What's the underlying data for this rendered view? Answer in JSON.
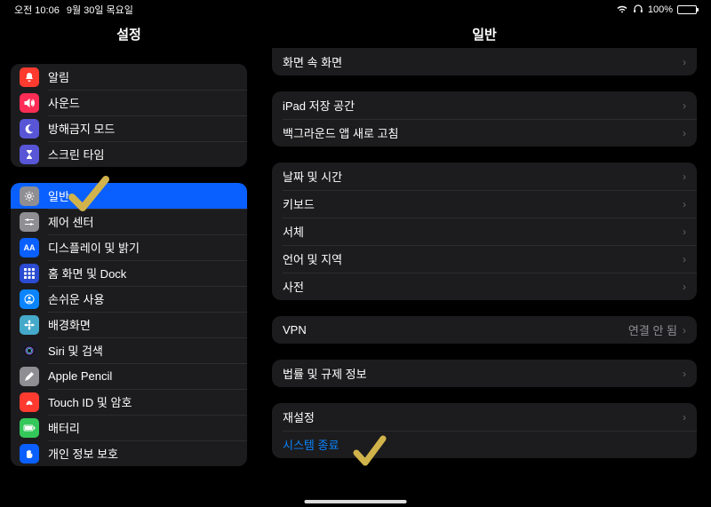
{
  "status": {
    "time": "오전 10:06",
    "date": "9월 30일 목요일",
    "battery": "100%"
  },
  "sidebar": {
    "title": "설정",
    "group1": [
      {
        "label": "알림",
        "color": "#ff3b30",
        "glyph": "bell"
      },
      {
        "label": "사운드",
        "color": "#ff2d55",
        "glyph": "speaker"
      },
      {
        "label": "방해금지 모드",
        "color": "#5856d6",
        "glyph": "moon"
      },
      {
        "label": "스크린 타임",
        "color": "#5856d6",
        "glyph": "hourglass"
      }
    ],
    "group2": [
      {
        "label": "일반",
        "color": "#8e8e93",
        "glyph": "gear",
        "selected": true
      },
      {
        "label": "제어 센터",
        "color": "#8e8e93",
        "glyph": "switches"
      },
      {
        "label": "디스플레이 및 밝기",
        "color": "#0a5fff",
        "glyph": "AA"
      },
      {
        "label": "홈 화면 및 Dock",
        "color": "#2b4bd1",
        "glyph": "grid"
      },
      {
        "label": "손쉬운 사용",
        "color": "#0a84ff",
        "glyph": "person"
      },
      {
        "label": "배경화면",
        "color": "#45a9c9",
        "glyph": "flower"
      },
      {
        "label": "Siri 및 검색",
        "color": "#1b1b25",
        "glyph": "siri"
      },
      {
        "label": "Apple Pencil",
        "color": "#8e8e93",
        "glyph": "pencil"
      },
      {
        "label": "Touch ID 및 암호",
        "color": "#ff3b30",
        "glyph": "finger"
      },
      {
        "label": "배터리",
        "color": "#34c759",
        "glyph": "battery"
      },
      {
        "label": "개인 정보 보호",
        "color": "#0a5fff",
        "glyph": "hand"
      }
    ]
  },
  "detail": {
    "title": "일반",
    "groups": [
      [
        {
          "label": "화면 속 화면"
        }
      ],
      [
        {
          "label": "iPad 저장 공간"
        },
        {
          "label": "백그라운드 앱 새로 고침"
        }
      ],
      [
        {
          "label": "날짜 및 시간"
        },
        {
          "label": "키보드"
        },
        {
          "label": "서체"
        },
        {
          "label": "언어 및 지역"
        },
        {
          "label": "사전"
        }
      ],
      [
        {
          "label": "VPN",
          "value": "연결 안 됨"
        }
      ],
      [
        {
          "label": "법률 및 규제 정보"
        }
      ],
      [
        {
          "label": "재설정"
        },
        {
          "label": "시스템 종료",
          "link": true,
          "noChevron": true
        }
      ]
    ]
  }
}
